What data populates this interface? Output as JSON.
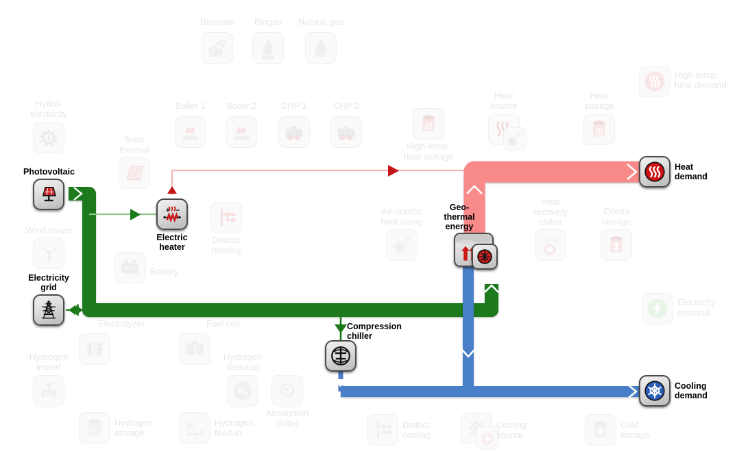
{
  "diagram": {
    "title": "Energy system flow diagram",
    "colors": {
      "electricity": "#1a7a1a",
      "electricity_thin": "#8dc98d",
      "heat": "#f98a8a",
      "heat_thin": "#f2b6b6",
      "heat_arrow": "#c41717",
      "cooling": "#4a7ec8",
      "ghost_text": "#e7e7e7",
      "active_text": "#000000"
    }
  },
  "active_nodes": [
    {
      "id": "photovoltaic",
      "label": "Photovoltaic",
      "icon": "solar-panel-icon"
    },
    {
      "id": "electricity-grid",
      "label": "Electricity\ngrid",
      "icon": "power-pylon-icon"
    },
    {
      "id": "electric-heater",
      "label": "Electric\nheater",
      "icon": "electric-heater-icon"
    },
    {
      "id": "geothermal-energy",
      "label": "Geo-\nthermal\nenergy",
      "icon": "geothermal-icon"
    },
    {
      "id": "ground-source-heat-pump",
      "label": "",
      "icon": "heat-pump-icon"
    },
    {
      "id": "compression-chiller",
      "label": "Compression\nchiller",
      "icon": "compression-chiller-icon"
    },
    {
      "id": "heat-demand",
      "label": "Heat\ndemand",
      "icon": "heat-waves-icon"
    },
    {
      "id": "cooling-demand",
      "label": "Cooling\ndemand",
      "icon": "snowflake-icon"
    }
  ],
  "ghost_nodes": [
    {
      "id": "biomass",
      "label": "Biomass",
      "icon": "biomass-logs-icon"
    },
    {
      "id": "biogas",
      "label": "Biogas",
      "icon": "biogas-flame-icon"
    },
    {
      "id": "natural-gas",
      "label": "Natural gas",
      "icon": "gas-flame-icon"
    },
    {
      "id": "hydro-electricity",
      "label": "Hydro-\nelectricity",
      "icon": "turbine-icon"
    },
    {
      "id": "solar-thermal",
      "label": "Solar\nthermal",
      "icon": "solar-collector-icon"
    },
    {
      "id": "boiler-1",
      "label": "Boiler 1",
      "icon": "boiler-icon"
    },
    {
      "id": "boiler-2",
      "label": "Boiler 2",
      "icon": "boiler-icon"
    },
    {
      "id": "chp-1",
      "label": "CHP 1",
      "icon": "chp-engine-icon"
    },
    {
      "id": "chp-2",
      "label": "CHP 2",
      "icon": "chp-engine-icon"
    },
    {
      "id": "high-temp-heat-storage",
      "label": "High-temp.\nheat storage",
      "icon": "heat-storage-tank-icon"
    },
    {
      "id": "heat-source",
      "label": "Heat\nsource",
      "icon": "heat-source-icon"
    },
    {
      "id": "heat-storage",
      "label": "Heat\nstorage",
      "icon": "heat-storage-tank-icon"
    },
    {
      "id": "high-temp-heat-demand",
      "label": "High-temp.\nheat demand",
      "icon": "heat-waves-round-icon"
    },
    {
      "id": "wind-power",
      "label": "Wind power",
      "icon": "wind-turbine-icon"
    },
    {
      "id": "district-heating",
      "label": "District\nheating",
      "icon": "district-network-icon"
    },
    {
      "id": "air-source-heat-pump",
      "label": "Air-source\nheat pump",
      "icon": "heat-pump-icon"
    },
    {
      "id": "heat-recovery-chiller",
      "label": "Heat\nrecovery\nchiller",
      "icon": "heat-recovery-chiller-icon"
    },
    {
      "id": "combi-storage",
      "label": "Combi\nstorage",
      "icon": "combi-storage-icon"
    },
    {
      "id": "battery",
      "label": "Battery",
      "icon": "battery-icon"
    },
    {
      "id": "electricity-demand",
      "label": "Electricity\ndemand",
      "icon": "bolt-round-icon"
    },
    {
      "id": "electrolyzer",
      "label": "Electrolyzer",
      "icon": "electrolyzer-icon"
    },
    {
      "id": "fuel-cell",
      "label": "Fuel cell",
      "icon": "fuel-cell-icon"
    },
    {
      "id": "hydrogen-demand",
      "label": "Hydrogen\ndemand",
      "icon": "h2-round-icon"
    },
    {
      "id": "hydrogen-import",
      "label": "Hydrogen\nimport",
      "icon": "h2-valve-icon"
    },
    {
      "id": "absorption-chiller",
      "label": "Absorption\nchiller",
      "icon": "absorption-chiller-icon"
    },
    {
      "id": "hydrogen-storage",
      "label": "Hydrogen\nstorage",
      "icon": "h2-tank-icon"
    },
    {
      "id": "hydrogen-feed-in",
      "label": "Hydrogen\nfeed-in",
      "icon": "h2-feedin-icon"
    },
    {
      "id": "district-cooling",
      "label": "District\ncooling",
      "icon": "district-network-icon"
    },
    {
      "id": "cooling-source",
      "label": "Cooling\nsource",
      "icon": "cooling-source-icon"
    },
    {
      "id": "cold-storage",
      "label": "Cold\nstorage",
      "icon": "cold-storage-tank-icon"
    }
  ],
  "flows": [
    {
      "id": "pv-to-bus",
      "from": "photovoltaic",
      "to": "electricity-bus",
      "carrier": "electricity",
      "weight": "thick"
    },
    {
      "id": "bus-to-electric-heater",
      "from": "electricity-bus",
      "to": "electric-heater",
      "carrier": "electricity",
      "weight": "thin"
    },
    {
      "id": "grid-to-bus",
      "from": "electricity-grid",
      "to": "electricity-bus",
      "carrier": "electricity",
      "weight": "thin",
      "bidirectional": true
    },
    {
      "id": "bus-to-compression-chiller",
      "from": "electricity-bus",
      "to": "compression-chiller",
      "carrier": "electricity",
      "weight": "thin"
    },
    {
      "id": "bus-to-heat-pump",
      "from": "electricity-bus",
      "to": "ground-source-heat-pump",
      "carrier": "electricity",
      "weight": "thick"
    },
    {
      "id": "electric-heater-to-heat-bus",
      "from": "electric-heater",
      "to": "heat-bus",
      "carrier": "heat",
      "weight": "thin"
    },
    {
      "id": "heat-pump-to-heat-bus",
      "from": "ground-source-heat-pump",
      "to": "heat-bus",
      "carrier": "heat",
      "weight": "thick"
    },
    {
      "id": "heat-bus-to-heat-demand",
      "from": "heat-bus",
      "to": "heat-demand",
      "carrier": "heat",
      "weight": "thick"
    },
    {
      "id": "compression-chiller-to-cool-bus",
      "from": "compression-chiller",
      "to": "cooling-bus",
      "carrier": "cooling",
      "weight": "thin"
    },
    {
      "id": "heat-pump-to-cool-bus",
      "from": "ground-source-heat-pump",
      "to": "cooling-bus",
      "carrier": "cooling",
      "weight": "thick"
    },
    {
      "id": "cool-bus-to-cooling-demand",
      "from": "cooling-bus",
      "to": "cooling-demand",
      "carrier": "cooling",
      "weight": "thick"
    }
  ]
}
